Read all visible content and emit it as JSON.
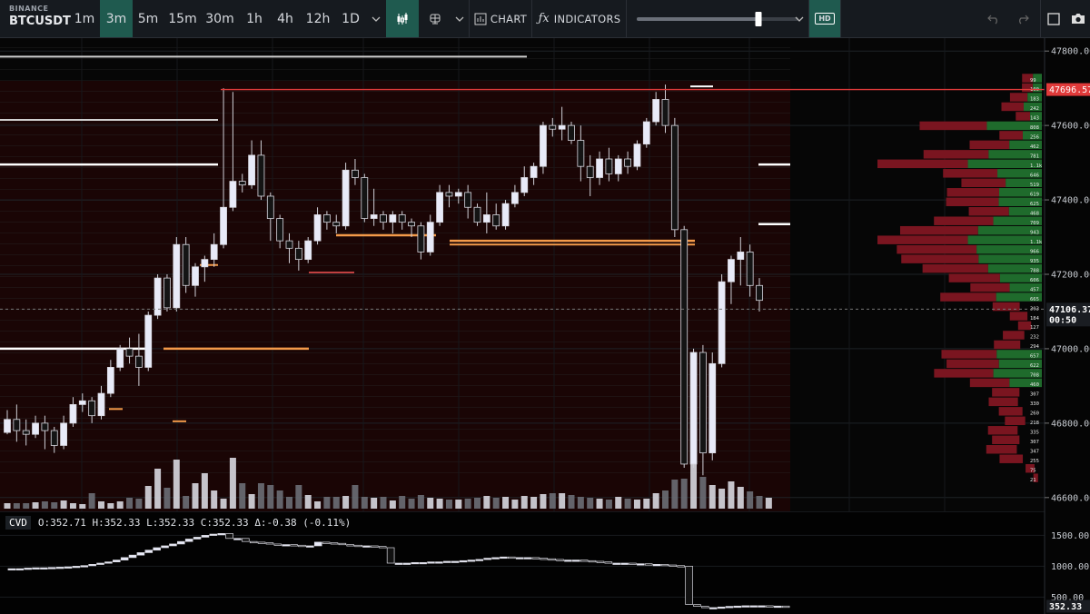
{
  "symbol": {
    "exchange": "BINANCE",
    "pair": "BTCUSDT"
  },
  "toolbar": {
    "timeframes": [
      "1m",
      "3m",
      "5m",
      "15m",
      "30m",
      "1h",
      "4h",
      "12h",
      "1D"
    ],
    "active_timeframe": "3m",
    "chart_label": "CHART",
    "indicators_label": "INDICATORS",
    "hd_label": "HD",
    "slider_level": 0.75
  },
  "colors": {
    "bull": "#e8eaf8",
    "bear": "#111111",
    "accent": "#1f5a4f",
    "red_line": "#e03a3a",
    "bid": "#1f6b2c",
    "ask": "#7a1520"
  },
  "chart_data": [
    {
      "type": "candlestick",
      "ylim": [
        46580,
        47820
      ],
      "y_ticks": [
        "46600.00",
        "46800.00",
        "47000.00",
        "47200.00",
        "47400.00",
        "47600.00",
        "47800.00"
      ],
      "price_label": "47106.37",
      "countdown": "00:50",
      "high_marker": "47696.57",
      "candles": [
        [
          46775,
          46835,
          46770,
          46810
        ],
        [
          46810,
          46850,
          46750,
          46780
        ],
        [
          46780,
          46810,
          46740,
          46770
        ],
        [
          46770,
          46820,
          46760,
          46800
        ],
        [
          46800,
          46820,
          46730,
          46780
        ],
        [
          46780,
          46790,
          46720,
          46740
        ],
        [
          46740,
          46820,
          46730,
          46800
        ],
        [
          46800,
          46870,
          46790,
          46850
        ],
        [
          46850,
          46880,
          46830,
          46860
        ],
        [
          46860,
          46870,
          46800,
          46820
        ],
        [
          46820,
          46900,
          46810,
          46880
        ],
        [
          46880,
          46970,
          46870,
          46950
        ],
        [
          46950,
          47010,
          46940,
          47000
        ],
        [
          47000,
          47030,
          46960,
          46980
        ],
        [
          46980,
          47040,
          46900,
          46950
        ],
        [
          46950,
          47100,
          46940,
          47090
        ],
        [
          47090,
          47200,
          47080,
          47190
        ],
        [
          47190,
          47200,
          47100,
          47110
        ],
        [
          47110,
          47300,
          47100,
          47280
        ],
        [
          47280,
          47300,
          47150,
          47170
        ],
        [
          47170,
          47230,
          47140,
          47220
        ],
        [
          47220,
          47250,
          47180,
          47240
        ],
        [
          47240,
          47310,
          47220,
          47280
        ],
        [
          47280,
          47700,
          47270,
          47380
        ],
        [
          47380,
          47690,
          47370,
          47450
        ],
        [
          47450,
          47470,
          47420,
          47440
        ],
        [
          47440,
          47560,
          47430,
          47520
        ],
        [
          47520,
          47560,
          47400,
          47410
        ],
        [
          47410,
          47420,
          47290,
          47350
        ],
        [
          47350,
          47360,
          47270,
          47290
        ],
        [
          47290,
          47310,
          47230,
          47270
        ],
        [
          47270,
          47290,
          47210,
          47240
        ],
        [
          47240,
          47300,
          47230,
          47290
        ],
        [
          47290,
          47380,
          47280,
          47360
        ],
        [
          47360,
          47370,
          47320,
          47340
        ],
        [
          47340,
          47360,
          47310,
          47330
        ],
        [
          47330,
          47500,
          47320,
          47480
        ],
        [
          47480,
          47510,
          47440,
          47460
        ],
        [
          47460,
          47470,
          47340,
          47350
        ],
        [
          47350,
          47430,
          47330,
          47360
        ],
        [
          47360,
          47370,
          47320,
          47340
        ],
        [
          47340,
          47370,
          47310,
          47360
        ],
        [
          47360,
          47370,
          47320,
          47340
        ],
        [
          47340,
          47350,
          47300,
          47330
        ],
        [
          47330,
          47340,
          47240,
          47260
        ],
        [
          47260,
          47360,
          47250,
          47340
        ],
        [
          47340,
          47440,
          47330,
          47420
        ],
        [
          47420,
          47440,
          47380,
          47410
        ],
        [
          47410,
          47430,
          47390,
          47420
        ],
        [
          47420,
          47440,
          47350,
          47380
        ],
        [
          47380,
          47390,
          47330,
          47340
        ],
        [
          47340,
          47420,
          47310,
          47360
        ],
        [
          47360,
          47390,
          47320,
          47330
        ],
        [
          47330,
          47400,
          47320,
          47390
        ],
        [
          47390,
          47440,
          47380,
          47420
        ],
        [
          47420,
          47490,
          47410,
          47460
        ],
        [
          47460,
          47500,
          47440,
          47490
        ],
        [
          47490,
          47610,
          47470,
          47600
        ],
        [
          47600,
          47620,
          47570,
          47590
        ],
        [
          47590,
          47650,
          47560,
          47600
        ],
        [
          47600,
          47610,
          47550,
          47560
        ],
        [
          47560,
          47600,
          47450,
          47490
        ],
        [
          47490,
          47520,
          47410,
          47460
        ],
        [
          47460,
          47530,
          47440,
          47510
        ],
        [
          47510,
          47540,
          47450,
          47470
        ],
        [
          47470,
          47520,
          47450,
          47510
        ],
        [
          47510,
          47530,
          47470,
          47490
        ],
        [
          47490,
          47560,
          47480,
          47550
        ],
        [
          47550,
          47620,
          47540,
          47610
        ],
        [
          47610,
          47690,
          47600,
          47670
        ],
        [
          47670,
          47710,
          47580,
          47600
        ],
        [
          47600,
          47620,
          47300,
          47320
        ],
        [
          47320,
          47330,
          46680,
          46690
        ],
        [
          46690,
          47000,
          46680,
          46990
        ],
        [
          46990,
          47010,
          46660,
          46720
        ],
        [
          46720,
          46990,
          46700,
          46960
        ],
        [
          46960,
          47200,
          46950,
          47180
        ],
        [
          47180,
          47250,
          47120,
          47240
        ],
        [
          47240,
          47300,
          47170,
          47260
        ],
        [
          47260,
          47280,
          47140,
          47170
        ],
        [
          47170,
          47190,
          47100,
          47130
        ]
      ],
      "volumes": [
        6,
        6,
        6,
        7,
        8,
        7,
        9,
        6,
        5,
        17,
        8,
        6,
        8,
        12,
        11,
        25,
        44,
        23,
        54,
        14,
        28,
        39,
        20,
        11,
        56,
        28,
        16,
        28,
        26,
        20,
        13,
        26,
        15,
        8,
        13,
        13,
        14,
        26,
        13,
        12,
        13,
        9,
        14,
        11,
        15,
        12,
        11,
        10,
        10,
        11,
        12,
        14,
        12,
        13,
        10,
        14,
        13,
        16,
        17,
        17,
        15,
        13,
        12,
        11,
        10,
        13,
        11,
        10,
        11,
        17,
        20,
        32,
        33,
        49,
        35,
        26,
        22,
        30,
        24,
        19,
        14,
        12
      ],
      "volume_ylim": [
        0,
        62
      ]
    },
    {
      "type": "line",
      "name": "CVD",
      "legend": {
        "tag": "CVD",
        "o": "O:352.71",
        "h": "H:352.33",
        "l": "L:352.33",
        "c": "C:352.33",
        "d": "Δ:-0.38 (-0.11%)"
      },
      "ylim": [
        300,
        1800
      ],
      "y_ticks": [
        "500.00",
        "1000.00",
        "1500.00"
      ],
      "last_value": "352.33",
      "values": [
        960,
        960,
        960,
        970,
        975,
        975,
        980,
        985,
        990,
        1000,
        1010,
        1030,
        1050,
        1070,
        1100,
        1140,
        1180,
        1220,
        1260,
        1300,
        1330,
        1360,
        1400,
        1440,
        1470,
        1500,
        1520,
        1530,
        1450,
        1450,
        1400,
        1390,
        1380,
        1360,
        1350,
        1350,
        1340,
        1330,
        1330,
        1390,
        1380,
        1370,
        1350,
        1340,
        1330,
        1330,
        1320,
        1300,
        1050,
        1050,
        1050,
        1060,
        1060,
        1070,
        1070,
        1080,
        1080,
        1090,
        1100,
        1110,
        1130,
        1140,
        1150,
        1140,
        1140,
        1140,
        1130,
        1120,
        1110,
        1100,
        1100,
        1100,
        1090,
        1080,
        1070,
        1050,
        1050,
        1050,
        1040,
        1040,
        1030,
        1030,
        1020,
        1010,
        1000,
        380,
        350,
        330,
        330,
        340,
        350,
        355,
        360,
        360,
        360,
        355,
        355,
        352
      ]
    }
  ],
  "order_book": {
    "labels": [
      "99",
      "100",
      "183",
      "242",
      "143",
      "808",
      "256",
      "462",
      "781",
      "1.1k",
      "646",
      "519",
      "619",
      "625",
      "468",
      "709",
      "943",
      "1.1k",
      "966",
      "935",
      "788",
      "606",
      "457",
      "665",
      "303",
      "184",
      "127",
      "232",
      "294",
      "657",
      "622",
      "708",
      "460",
      "307",
      "330",
      "260",
      "218",
      "335",
      "307",
      "347",
      "255",
      "75",
      "21"
    ]
  }
}
